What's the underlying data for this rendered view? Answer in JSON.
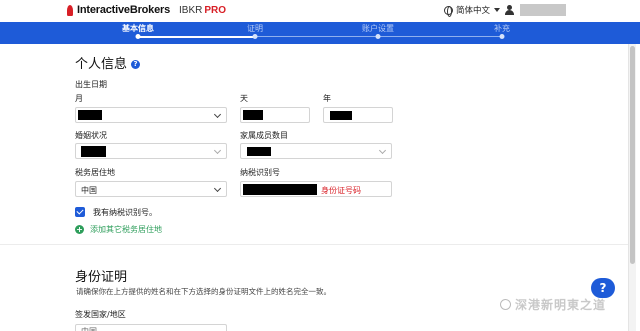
{
  "header": {
    "brand": "InteractiveBrokers",
    "product": "IBKR",
    "product_tier": "PRO",
    "language": "简体中文",
    "icons": [
      "logo-flame-icon",
      "globe-icon",
      "chevron-down-icon",
      "user-icon"
    ]
  },
  "progress": {
    "steps": [
      {
        "label": "基本信息",
        "active": true
      },
      {
        "label": "证明",
        "active": false
      },
      {
        "label": "账户设置",
        "active": false
      },
      {
        "label": "补充",
        "active": false
      }
    ]
  },
  "personal": {
    "title": "个人信息",
    "help_icon": "?",
    "dob_label": "出生日期",
    "month_label": "月",
    "day_label": "天",
    "year_label": "年",
    "marital_label": "婚姻状况",
    "family_label": "家属成员数目",
    "tax_residence_label": "税务居住地",
    "tax_residence_value": "中国",
    "tax_id_label": "纳税识别号",
    "tax_id_hint": "身份证号码",
    "has_tax_id_label": "我有纳税识别号。",
    "has_tax_id_checked": true,
    "add_tax_residence": "添加其它税务居住地",
    "add_icon": "+"
  },
  "identity": {
    "title": "身份证明",
    "note": "请确保你在上方提供的姓名和在下方选择的身份证明文件上的姓名完全一致。",
    "issuing_country_label": "签发国家/地区",
    "issuing_country_value": "中国"
  },
  "chat": {
    "icon": "?"
  },
  "watermark": {
    "text": "深港新明東之道"
  },
  "colors": {
    "accent": "#1e5bd8",
    "brand_red": "#d81f26",
    "success": "#2e9e5b"
  }
}
